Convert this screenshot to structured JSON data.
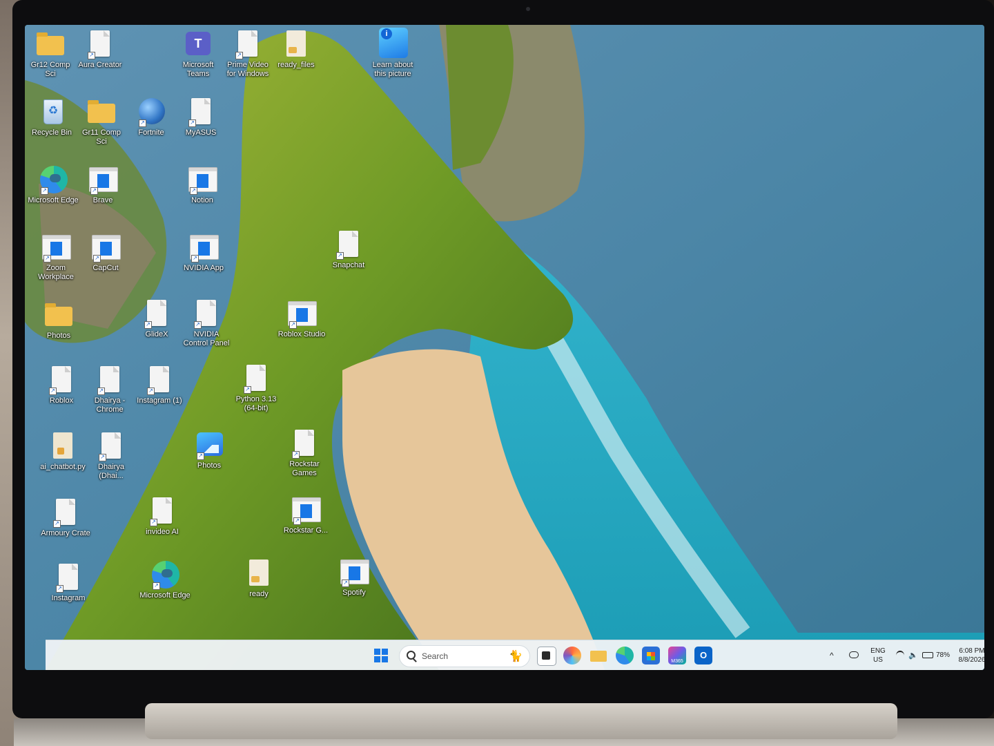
{
  "desktop": {
    "icons": {
      "gr12_comp_sci": "Gr12 Comp Sci",
      "aura_creator": "Aura Creator",
      "microsoft_teams": "Microsoft Teams",
      "prime_video": "Prime Video for Windows",
      "ready_files": "ready_files",
      "learn_about": "Learn about this picture",
      "recycle_bin": "Recycle Bin",
      "gr11_comp_sci": "Gr11 Comp Sci",
      "fortnite": "Fortnite",
      "myasus": "MyASUS",
      "microsoft_edge_1": "Microsoft Edge",
      "brave": "Brave",
      "notion": "Notion",
      "zoom_workplace": "Zoom Workplace",
      "capcut": "CapCut",
      "nvidia_app": "NVIDIA App",
      "snapchat": "Snapchat",
      "photos_folder": "Photos",
      "glidex": "GlideX",
      "nvidia_control_panel": "NVIDIA Control Panel",
      "roblox_studio": "Roblox Studio",
      "roblox": "Roblox",
      "dhairya_chrome": "Dhairya - Chrome",
      "instagram_1": "Instagram (1)",
      "python": "Python 3.13 (64-bit)",
      "ai_chatbot": "ai_chatbot.py",
      "dhairya_dhai": "Dhairya (Dhai...",
      "photos_app": "Photos",
      "rockstar_games": "Rockstar Games",
      "armoury_crate": "Armoury Crate",
      "invideo_ai": "invideo AI",
      "rockstar_g": "Rockstar G...",
      "instagram": "Instagram",
      "microsoft_edge_2": "Microsoft Edge",
      "ready": "ready",
      "spotify": "Spotify"
    }
  },
  "taskbar": {
    "search_placeholder": "Search",
    "search_mascot": "🐈",
    "apps": [
      "task-view",
      "copilot",
      "file-explorer",
      "edge",
      "microsoft-store",
      "m365",
      "outlook"
    ],
    "m365_label": "M365",
    "outlook_label": "O",
    "tray": {
      "chevron": "^",
      "language": "ENG",
      "region": "US",
      "battery": "78%",
      "time": "6:08 PM",
      "date": "8/8/2026"
    }
  },
  "colors": {
    "accent": "#1877e6",
    "ocean": "#2f6e8f",
    "turquoise": "#27b8c9",
    "cliff_green": "#7ea82c",
    "sand": "#e8c9a0"
  }
}
